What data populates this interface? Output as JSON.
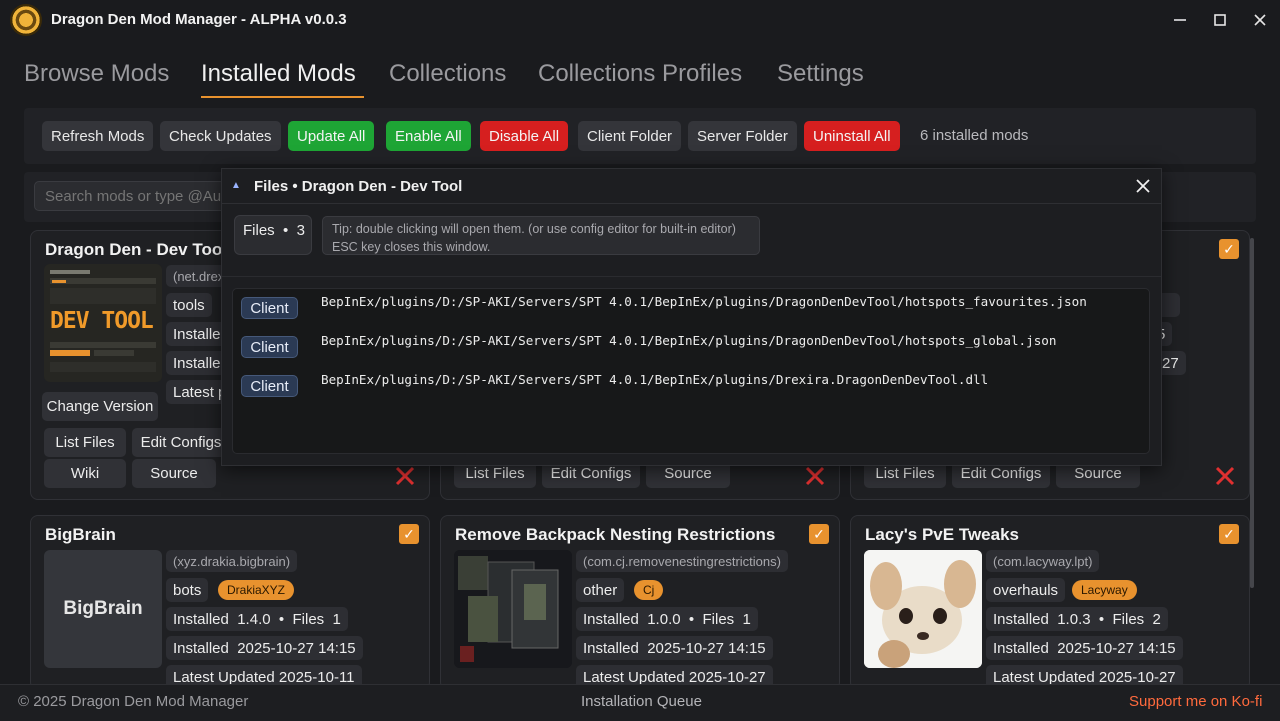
{
  "window": {
    "title": "Dragon Den Mod Manager - ALPHA v0.0.3",
    "minimize_icon": "minimize-icon",
    "maximize_icon": "maximize-icon",
    "close_icon": "close-icon"
  },
  "tabs": [
    {
      "label": "Browse Mods",
      "active": false
    },
    {
      "label": "Installed Mods",
      "active": true
    },
    {
      "label": "Collections",
      "active": false
    },
    {
      "label": "Collections Profiles",
      "active": false
    },
    {
      "label": "Settings",
      "active": false
    }
  ],
  "toolbar": {
    "refresh": "Refresh Mods",
    "check_updates": "Check Updates",
    "update_all": "Update All",
    "enable_all": "Enable All",
    "disable_all": "Disable All",
    "client_folder": "Client Folder",
    "server_folder": "Server Folder",
    "uninstall_all": "Uninstall All",
    "count": "6 installed mods"
  },
  "search": {
    "placeholder": "Search mods or type @Aut"
  },
  "colors": {
    "accent": "#e8922e",
    "green": "#1ea535",
    "red": "#d61f1f",
    "client_tag": "#2b3a54"
  },
  "cards_top": {
    "first": {
      "title": "Dragon Den - Dev Tool",
      "thumb_text": "DEV TOOL",
      "id": "(net.drex",
      "category": "tools",
      "installed_partial": "Installe",
      "installed_partial2": "Installe",
      "latest_partial": "Latest p",
      "change_version": "Change Version",
      "list_files": "List Files",
      "edit_configs": "Edit Configs",
      "wiki": "Wiki",
      "source": "Source"
    },
    "second": {
      "list_files": "List Files",
      "edit_configs": "Edit Configs",
      "source": "Source"
    },
    "third": {
      "list_files": "List Files",
      "edit_configs": "Edit Configs",
      "source": "Source",
      "partial_5": "5",
      "partial_27": "-27"
    }
  },
  "cards_bottom": [
    {
      "title": "BigBrain",
      "thumb_text": "BigBrain",
      "id": "(xyz.drakia.bigbrain)",
      "category": "bots",
      "author": "DrakiaXYZ",
      "installed_label": "Installed",
      "version": "1.4.0",
      "files_label": "Files",
      "files": "1",
      "installed_date": "2025-10-27 14:15",
      "cut_line": "Latest Updated 2025-10-11"
    },
    {
      "title": "Remove Backpack Nesting Restrictions",
      "id": "(com.cj.removenestingrestrictions)",
      "category": "other",
      "author": "Cj",
      "installed_label": "Installed",
      "version": "1.0.0",
      "files_label": "Files",
      "files": "1",
      "installed_date": "2025-10-27 14:15",
      "cut_line": "Latest Updated 2025-10-27"
    },
    {
      "title": "Lacy's PvE Tweaks",
      "id": "(com.lacyway.lpt)",
      "category": "overhauls",
      "author": "Lacyway",
      "installed_label": "Installed",
      "version": "1.0.3",
      "files_label": "Files",
      "files": "2",
      "installed_date": "2025-10-27 14:15",
      "cut_line": "Latest Updated 2025-10-27"
    }
  ],
  "modal": {
    "title": "Files • Dragon Den - Dev Tool",
    "files_label": "Files",
    "files_count": "3",
    "tip_line1": "Tip: double clicking will open them. (or use config editor for built-in editor)",
    "tip_line2": "ESC key closes this window.",
    "files": [
      {
        "tag": "Client",
        "path": "BepInEx/plugins/D:/SP-AKI/Servers/SPT 4.0.1/BepInEx/plugins/DragonDenDevTool/hotspots_favourites.json"
      },
      {
        "tag": "Client",
        "path": "BepInEx/plugins/D:/SP-AKI/Servers/SPT 4.0.1/BepInEx/plugins/DragonDenDevTool/hotspots_global.json"
      },
      {
        "tag": "Client",
        "path": "BepInEx/plugins/D:/SP-AKI/Servers/SPT 4.0.1/BepInEx/plugins/Drexira.DragonDenDevTool.dll"
      }
    ]
  },
  "footer": {
    "copyright": "© 2025 Dragon Den Mod Manager",
    "queue": "Installation Queue",
    "support": "Support me on Ko-fi"
  }
}
